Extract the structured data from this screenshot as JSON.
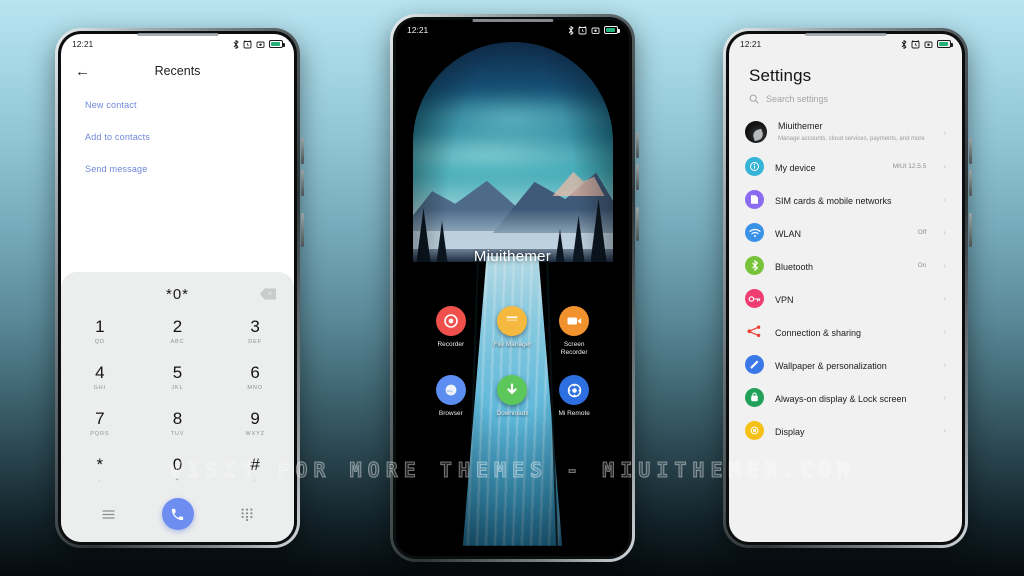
{
  "background": {
    "top_color": "#b8e4ef",
    "bottom_color": "#050a0d"
  },
  "watermark": {
    "text": "VISIT FOR MORE THEMES - MIUITHEMER.COM"
  },
  "phone1": {
    "status": {
      "time": "12:21",
      "icons": [
        "bluetooth-icon",
        "alarm-icon",
        "screenshot-icon",
        "battery-icon"
      ]
    },
    "header": {
      "back": "←",
      "title": "Recents"
    },
    "links": [
      {
        "label": "New contact"
      },
      {
        "label": "Add to contacts"
      },
      {
        "label": "Send message"
      }
    ],
    "dialer": {
      "number": "*0*",
      "delete_icon": "backspace-icon",
      "keys": [
        {
          "digit": "1",
          "letters": "QD"
        },
        {
          "digit": "2",
          "letters": "ABC"
        },
        {
          "digit": "3",
          "letters": "DEF"
        },
        {
          "digit": "4",
          "letters": "GHI"
        },
        {
          "digit": "5",
          "letters": "JKL"
        },
        {
          "digit": "6",
          "letters": "MNO"
        },
        {
          "digit": "7",
          "letters": "PQRS"
        },
        {
          "digit": "8",
          "letters": "TUV"
        },
        {
          "digit": "9",
          "letters": "WXYZ"
        },
        {
          "digit": "*",
          "letters": ","
        },
        {
          "digit": "0",
          "letters": "+"
        },
        {
          "digit": "#",
          "letters": ";"
        }
      ],
      "nav": {
        "menu_icon": "hamburger-menu-icon",
        "call_icon": "phone-call-icon",
        "keypad_icon": "dialpad-icon",
        "call_button_color": "#6d8ef0"
      }
    }
  },
  "phone2": {
    "status": {
      "time": "12:21",
      "icons": [
        "bluetooth-icon",
        "alarm-icon",
        "screenshot-icon",
        "battery-icon"
      ]
    },
    "wallpaper_name": "mountain-aurora-waterfall",
    "clock_label": "Miuithemer",
    "apps": [
      {
        "label": "Recorder",
        "icon": "recorder-icon",
        "color": "#f0504b"
      },
      {
        "label": "File Manager",
        "icon": "folder-icon",
        "color": "#f5b93f"
      },
      {
        "label": "Screen Recorder",
        "icon": "video-camera-icon",
        "color": "#f2922e"
      },
      {
        "label": "Browser",
        "icon": "browser-globe-icon",
        "color": "#5b8ef0"
      },
      {
        "label": "Downloads",
        "icon": "download-arrow-icon",
        "color": "#5cc85c"
      },
      {
        "label": "Mi Remote",
        "icon": "remote-control-icon",
        "color": "#2d6fe0"
      }
    ]
  },
  "phone3": {
    "status": {
      "time": "12:21",
      "icons": [
        "bluetooth-icon",
        "alarm-icon",
        "screenshot-icon",
        "battery-icon"
      ]
    },
    "title": "Settings",
    "search": {
      "placeholder": "Search settings",
      "icon": "search-icon"
    },
    "account": {
      "name": "Miuithemer",
      "subtitle": "Manage accounts, cloud services, payments, and more",
      "avatar": "user-avatar"
    },
    "items": [
      {
        "label": "My device",
        "value": "MIUI 12.5.5",
        "icon": "info-circle-icon",
        "color": "#35b4d8"
      },
      {
        "label": "SIM cards & mobile networks",
        "value": "",
        "icon": "sim-card-icon",
        "color": "#8b6cf0"
      },
      {
        "label": "WLAN",
        "value": "Off",
        "icon": "wifi-icon",
        "color": "#3a92e8"
      },
      {
        "label": "Bluetooth",
        "value": "On",
        "icon": "bluetooth-icon",
        "color": "#77c43a"
      },
      {
        "label": "VPN",
        "value": "",
        "icon": "vpn-key-icon",
        "color": "#ef3d72"
      },
      {
        "label": "Connection & sharing",
        "value": "",
        "icon": "share-icon",
        "color": "#ef3d35"
      },
      {
        "label": "Wallpaper & personalization",
        "value": "",
        "icon": "brush-icon",
        "color": "#3a78e8"
      },
      {
        "label": "Always-on display & Lock screen",
        "value": "",
        "icon": "lock-screen-icon",
        "color": "#21a05a"
      },
      {
        "label": "Display",
        "value": "",
        "icon": "brightness-icon",
        "color": "#f5c117"
      }
    ],
    "chevron": "›"
  }
}
